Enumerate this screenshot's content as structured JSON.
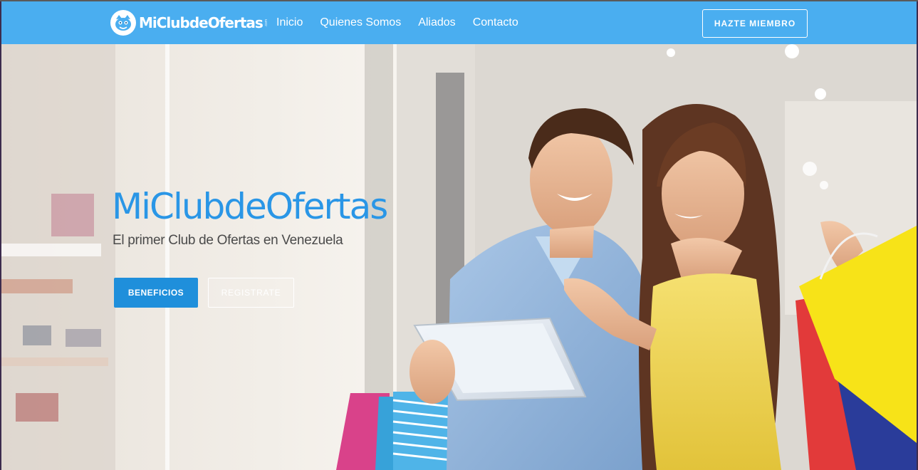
{
  "navbar": {
    "logo_text": "MiClubdeOfertas",
    "logo_suffix": ".com",
    "links": [
      "Inicio",
      "Quienes Somos",
      "Aliados",
      "Contacto"
    ],
    "cta_label": "HAZTE MIEMBRO"
  },
  "hero": {
    "title": "MiClubdeOfertas",
    "subtitle": "El primer Club de Ofertas en Venezuela",
    "primary_button": "BENEFICIOS",
    "secondary_button": "REGISTRATE"
  },
  "colors": {
    "navbar": "#4aaef0",
    "accent": "#2a96e6",
    "button": "#1f8fdb"
  },
  "icons": {
    "logo": "mascot-face-icon"
  }
}
